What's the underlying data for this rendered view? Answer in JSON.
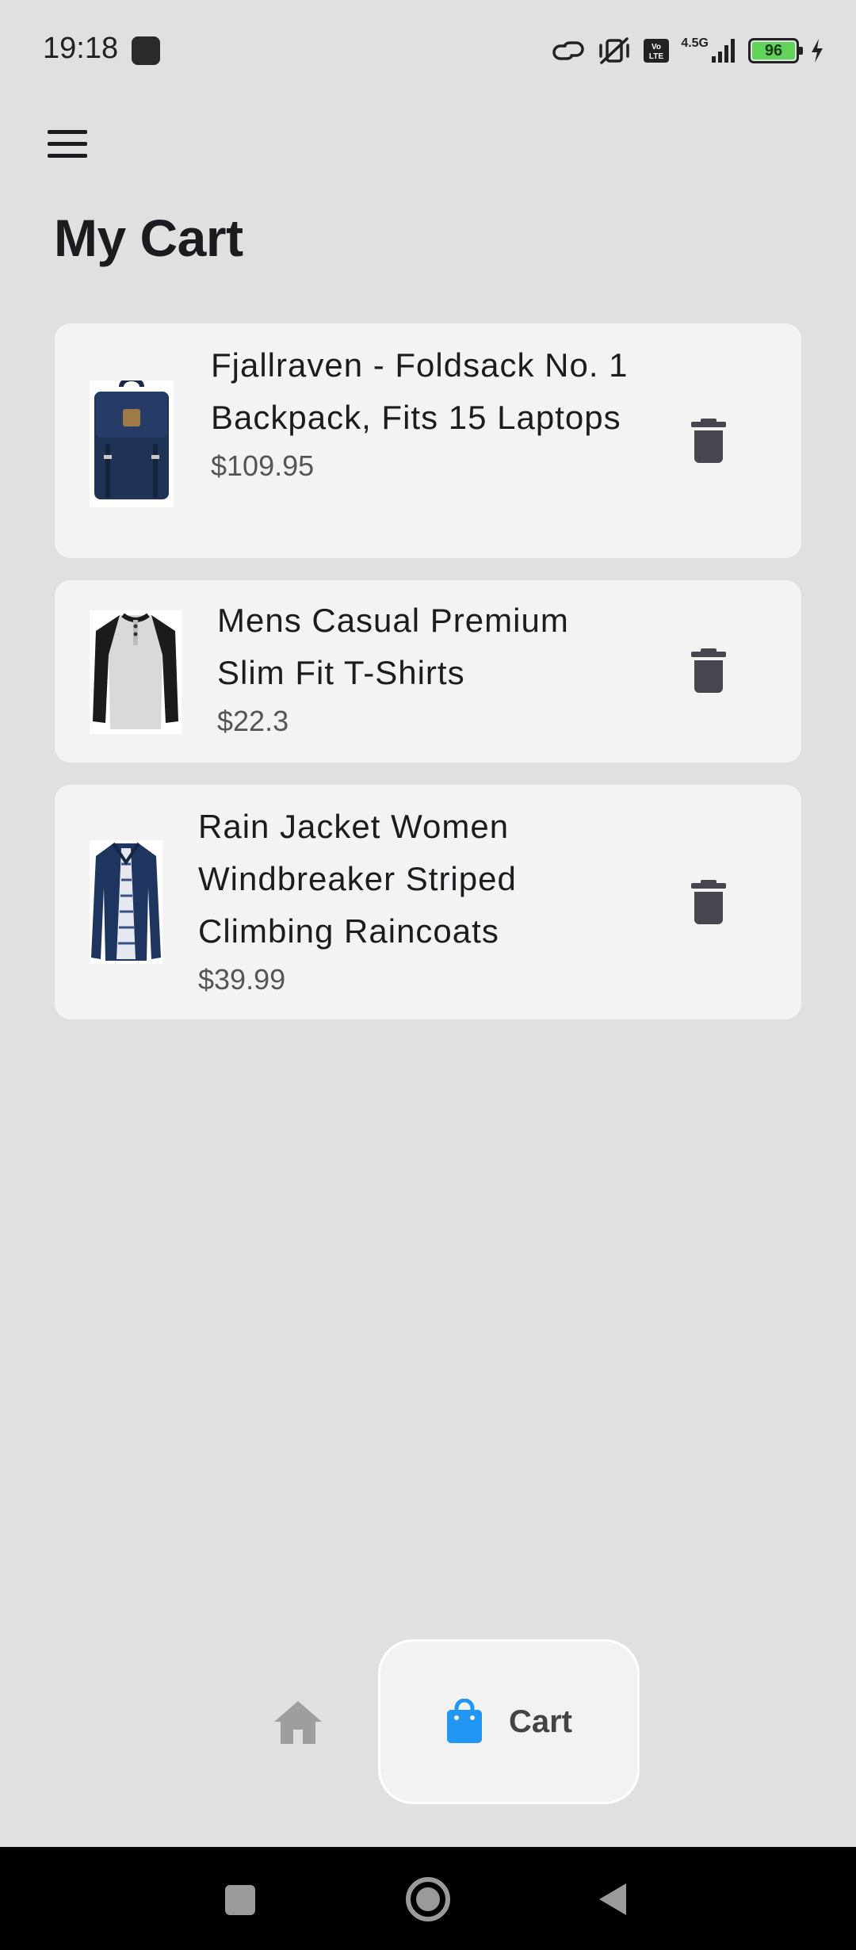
{
  "status_bar": {
    "time": "19:18",
    "network_label": "4.5G",
    "volte_label": "Vo LTE",
    "battery_level": "96"
  },
  "header": {
    "menu_icon": "hamburger-menu-icon",
    "title": "My Cart"
  },
  "cart": {
    "items": [
      {
        "name": "Fjallraven - Foldsack No. 1 Backpack, Fits 15 Laptops",
        "price": "$109.95",
        "image": "backpack-image",
        "delete_icon": "trash-icon"
      },
      {
        "name": "Mens Casual Premium Slim Fit T-Shirts",
        "price": "$22.3",
        "image": "tshirt-image",
        "delete_icon": "trash-icon"
      },
      {
        "name": "Rain Jacket Women Windbreaker Striped Climbing Raincoats",
        "price": "$39.99",
        "image": "raincoat-image",
        "delete_icon": "trash-icon"
      }
    ]
  },
  "bottom_nav": {
    "home_icon": "home-icon",
    "cart_icon": "shopping-bag-icon",
    "cart_label": "Cart",
    "active_color": "#2196f3",
    "inactive_color": "#9e9e9e"
  },
  "system_nav": {
    "recents": "square-icon",
    "home": "circle-icon",
    "back": "triangle-back-icon"
  }
}
